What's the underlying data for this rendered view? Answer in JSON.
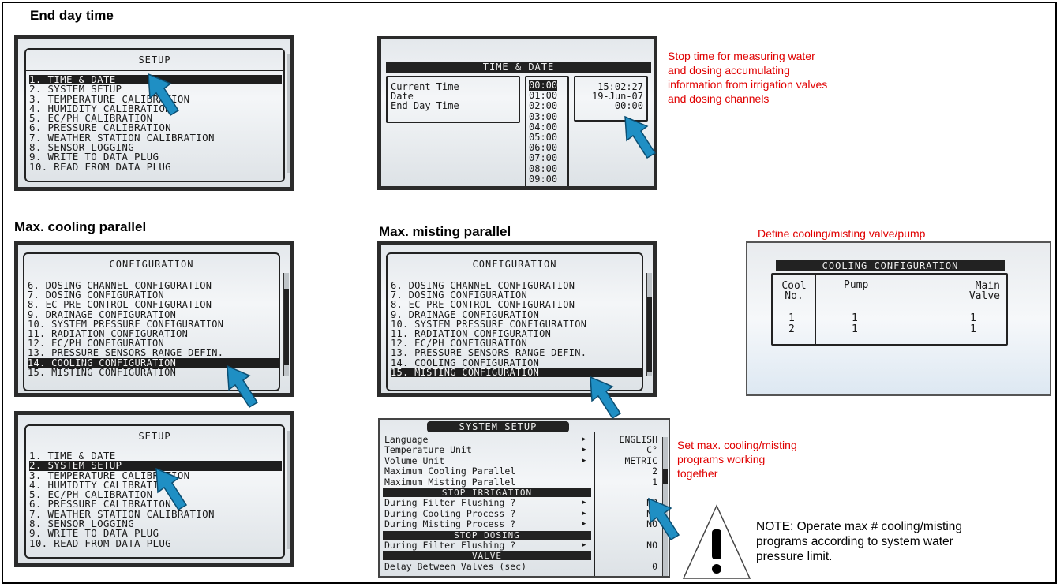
{
  "headings": {
    "end_day": "End day time",
    "max_cooling": "Max. cooling parallel",
    "max_misting": "Max. misting parallel"
  },
  "annotations": {
    "stop_time": [
      "Stop time for measuring water",
      "and dosing accumulating",
      "information from irrigation valves",
      "and dosing channels"
    ],
    "define_cooling": "Define cooling/misting valve/pump",
    "set_max": [
      "Set max. cooling/misting",
      "programs working",
      "together"
    ],
    "note": [
      "NOTE:  Operate max # cooling/misting",
      "programs according to system water",
      "pressure limit."
    ]
  },
  "setup_screen_1": {
    "title": "SETUP",
    "items": [
      "1. TIME & DATE",
      "2. SYSTEM SETUP",
      "3. TEMPERATURE CALIBRATION",
      "4. HUMIDITY CALIBRATION",
      "5. EC/PH CALIBRATION",
      "6. PRESSURE CALIBRATION",
      "7. WEATHER STATION CALIBRATION",
      "8. SENSOR LOGGING",
      "9. WRITE TO DATA PLUG",
      "10. READ FROM DATA PLUG"
    ],
    "selected_index": 0
  },
  "setup_screen_2": {
    "title": "SETUP",
    "items": [
      "1. TIME & DATE",
      "2. SYSTEM SETUP",
      "3. TEMPERATURE CALIBRATION",
      "4. HUMIDITY CALIBRATION",
      "5. EC/PH CALIBRATION",
      "6. PRESSURE CALIBRATION",
      "7. WEATHER STATION CALIBRATION",
      "8. SENSOR LOGGING",
      "9. WRITE TO DATA PLUG",
      "10. READ FROM DATA PLUG"
    ],
    "selected_index": 1
  },
  "time_date_screen": {
    "title": "TIME & DATE",
    "labels": [
      "Current Time",
      "Date",
      "End Day Time"
    ],
    "values": [
      "15:02:27",
      "19-Jun-07",
      "00:00"
    ],
    "dropdown_options": [
      "00:00",
      "01:00",
      "02:00",
      "03:00",
      "04:00",
      "05:00",
      "06:00",
      "07:00",
      "08:00",
      "09:00"
    ]
  },
  "config_screen_cooling": {
    "title": "CONFIGURATION",
    "items": [
      "6. DOSING CHANNEL CONFIGURATION",
      "7. DOSING CONFIGURATION",
      "8. EC PRE-CONTROL CONFIGURATION",
      "9. DRAINAGE CONFIGURATION",
      "10. SYSTEM PRESSURE CONFIGURATION",
      "11. RADIATION CONFIGURATION",
      "12. EC/PH CONFIGURATION",
      "13. PRESSURE SENSORS RANGE DEFIN.",
      "14. COOLING CONFIGURATION",
      "15. MISTING CONFIGURATION"
    ],
    "selected_index": 8
  },
  "config_screen_misting": {
    "title": "CONFIGURATION",
    "items": [
      "6. DOSING CHANNEL CONFIGURATION",
      "7. DOSING CONFIGURATION",
      "8. EC PRE-CONTROL CONFIGURATION",
      "9. DRAINAGE CONFIGURATION",
      "10. SYSTEM PRESSURE CONFIGURATION",
      "11. RADIATION CONFIGURATION",
      "12. EC/PH CONFIGURATION",
      "13. PRESSURE SENSORS RANGE DEFIN.",
      "14. COOLING CONFIGURATION",
      "15. MISTING CONFIGURATION"
    ],
    "selected_index": 9
  },
  "cooling_config_screen": {
    "title": "COOLING CONFIGURATION",
    "headers": [
      "Cool No.",
      "Pump",
      "Main Valve"
    ],
    "rows": [
      [
        "1",
        "1",
        "1"
      ],
      [
        "2",
        "1",
        "1"
      ]
    ]
  },
  "system_setup_screen": {
    "title": "SYSTEM SETUP",
    "rows": [
      {
        "label": "Language",
        "value": "ENGLISH",
        "arrow": true
      },
      {
        "label": "Temperature Unit",
        "value": "C°",
        "arrow": true
      },
      {
        "label": "Volume Unit",
        "value": "METRIC",
        "arrow": true
      },
      {
        "label": "Maximum Cooling Parallel",
        "value": "2",
        "arrow": false
      },
      {
        "label": "Maximum Misting Parallel",
        "value": "1",
        "arrow": false
      },
      {
        "section": "STOP IRRIGATION"
      },
      {
        "label": "During Filter Flushing ?",
        "value": "NO",
        "arrow": true
      },
      {
        "label": "During Cooling Process ?",
        "value": "NO",
        "arrow": true
      },
      {
        "label": "During Misting Process ?",
        "value": "NO",
        "arrow": true
      },
      {
        "section": "STOP DOSING"
      },
      {
        "label": "During Filter Flushing ?",
        "value": "NO",
        "arrow": true
      },
      {
        "section": "VALVE"
      },
      {
        "label": "Delay Between Valves (sec)",
        "value": "0",
        "arrow": false
      }
    ]
  },
  "colors": {
    "annotation_red": "#e00000",
    "pointer_blue": "#1f8fc4",
    "lcd_dark": "#1e1e1e"
  }
}
